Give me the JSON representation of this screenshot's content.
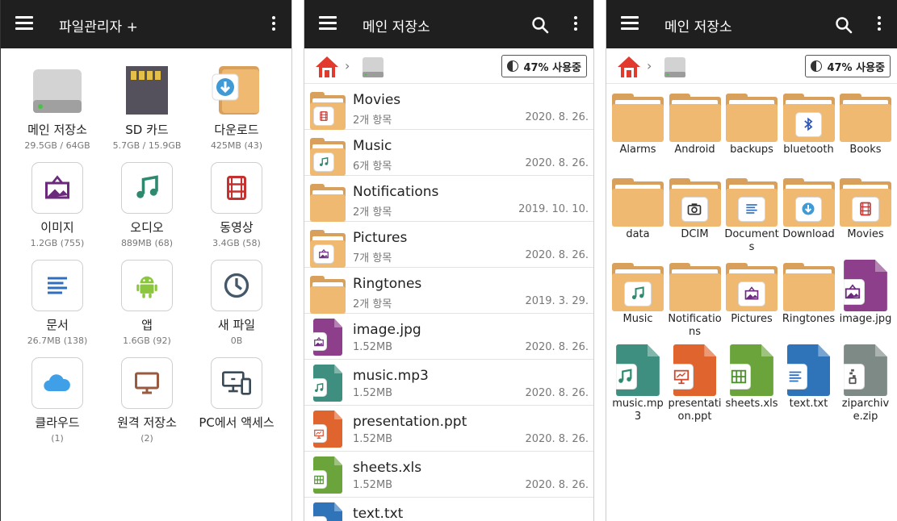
{
  "colors": {
    "appbar": "#1f1f1f",
    "folder": "#efb972",
    "folder_back": "#d9a05b"
  },
  "panel1": {
    "title": "파일관리자 +",
    "items": [
      {
        "label": "메인 저장소",
        "sub": "29.5GB / 64GB",
        "icon": "hdd-icon"
      },
      {
        "label": "SD 카드",
        "sub": "5.7GB / 15.9GB",
        "icon": "sd-card-icon"
      },
      {
        "label": "다운로드",
        "sub": "425MB (43)",
        "icon": "download-folder-icon"
      },
      {
        "label": "이미지",
        "sub": "1.2GB (755)",
        "icon": "image-icon"
      },
      {
        "label": "오디오",
        "sub": "889MB (68)",
        "icon": "music-note-icon"
      },
      {
        "label": "동영상",
        "sub": "3.4GB (58)",
        "icon": "film-icon"
      },
      {
        "label": "문서",
        "sub": "26.7MB (138)",
        "icon": "document-icon"
      },
      {
        "label": "앱",
        "sub": "1.6GB (92)",
        "icon": "android-icon"
      },
      {
        "label": "새 파일",
        "sub": "0B",
        "icon": "clock-icon"
      },
      {
        "label": "클라우드",
        "sub": "(1)",
        "icon": "cloud-icon"
      },
      {
        "label": "원격 저장소",
        "sub": "(2)",
        "icon": "monitor-icon"
      },
      {
        "label": "PC에서 액세스",
        "sub": "",
        "icon": "pc-phone-icon"
      }
    ]
  },
  "panel2": {
    "title": "메인 저장소",
    "usage": "47% 사용중",
    "rows": [
      {
        "name": "Movies",
        "meta": "2개 항목",
        "date": "2020. 8. 26.",
        "kind": "folder",
        "badge": "film"
      },
      {
        "name": "Music",
        "meta": "6개 항목",
        "date": "2020. 8. 26.",
        "kind": "folder",
        "badge": "music"
      },
      {
        "name": "Notifications",
        "meta": "2개 항목",
        "date": "2019. 10. 10.",
        "kind": "folder",
        "badge": ""
      },
      {
        "name": "Pictures",
        "meta": "7개 항목",
        "date": "2020. 8. 26.",
        "kind": "folder",
        "badge": "image"
      },
      {
        "name": "Ringtones",
        "meta": "2개 항목",
        "date": "2019. 3. 29.",
        "kind": "folder",
        "badge": ""
      },
      {
        "name": "image.jpg",
        "meta": "1.52MB",
        "date": "2020. 8. 26.",
        "kind": "file",
        "badge": "image",
        "color": "#8e3f8c"
      },
      {
        "name": "music.mp3",
        "meta": "1.52MB",
        "date": "2020. 8. 26.",
        "kind": "file",
        "badge": "music",
        "color": "#3e8f80"
      },
      {
        "name": "presentation.ppt",
        "meta": "1.52MB",
        "date": "2020. 8. 26.",
        "kind": "file",
        "badge": "ppt",
        "color": "#e0642e"
      },
      {
        "name": "sheets.xls",
        "meta": "1.52MB",
        "date": "2020. 8. 26.",
        "kind": "file",
        "badge": "xls",
        "color": "#6aa43b"
      },
      {
        "name": "text.txt",
        "meta": "",
        "date": "",
        "kind": "file",
        "badge": "doc",
        "color": "#2f73b8"
      }
    ]
  },
  "panel3": {
    "title": "메인 저장소",
    "usage": "47% 사용중",
    "cells": [
      {
        "name": "Alarms",
        "kind": "folder",
        "badge": ""
      },
      {
        "name": "Android",
        "kind": "folder",
        "badge": ""
      },
      {
        "name": "backups",
        "kind": "folder",
        "badge": ""
      },
      {
        "name": "bluetooth",
        "kind": "folder",
        "badge": "bluetooth"
      },
      {
        "name": "Books",
        "kind": "folder",
        "badge": ""
      },
      {
        "name": "data",
        "kind": "folder",
        "badge": ""
      },
      {
        "name": "DCIM",
        "kind": "folder",
        "badge": "camera"
      },
      {
        "name": "Documents",
        "kind": "folder",
        "badge": "doc"
      },
      {
        "name": "Download",
        "kind": "folder",
        "badge": "download"
      },
      {
        "name": "Movies",
        "kind": "folder",
        "badge": "film"
      },
      {
        "name": "Music",
        "kind": "folder",
        "badge": "music"
      },
      {
        "name": "Notifications",
        "kind": "folder",
        "badge": ""
      },
      {
        "name": "Pictures",
        "kind": "folder",
        "badge": "image"
      },
      {
        "name": "Ringtones",
        "kind": "folder",
        "badge": ""
      },
      {
        "name": "image.jpg",
        "kind": "file",
        "badge": "image",
        "color": "#8e3f8c"
      },
      {
        "name": "music.mp3",
        "kind": "file",
        "badge": "music",
        "color": "#3e8f80"
      },
      {
        "name": "presentation.ppt",
        "kind": "file",
        "badge": "ppt",
        "color": "#e0642e"
      },
      {
        "name": "sheets.xls",
        "kind": "file",
        "badge": "xls",
        "color": "#6aa43b"
      },
      {
        "name": "text.txt",
        "kind": "file",
        "badge": "doc",
        "color": "#2f73b8"
      },
      {
        "name": "ziparchive.zip",
        "kind": "file",
        "badge": "zip",
        "color": "#7d8a86"
      }
    ]
  }
}
